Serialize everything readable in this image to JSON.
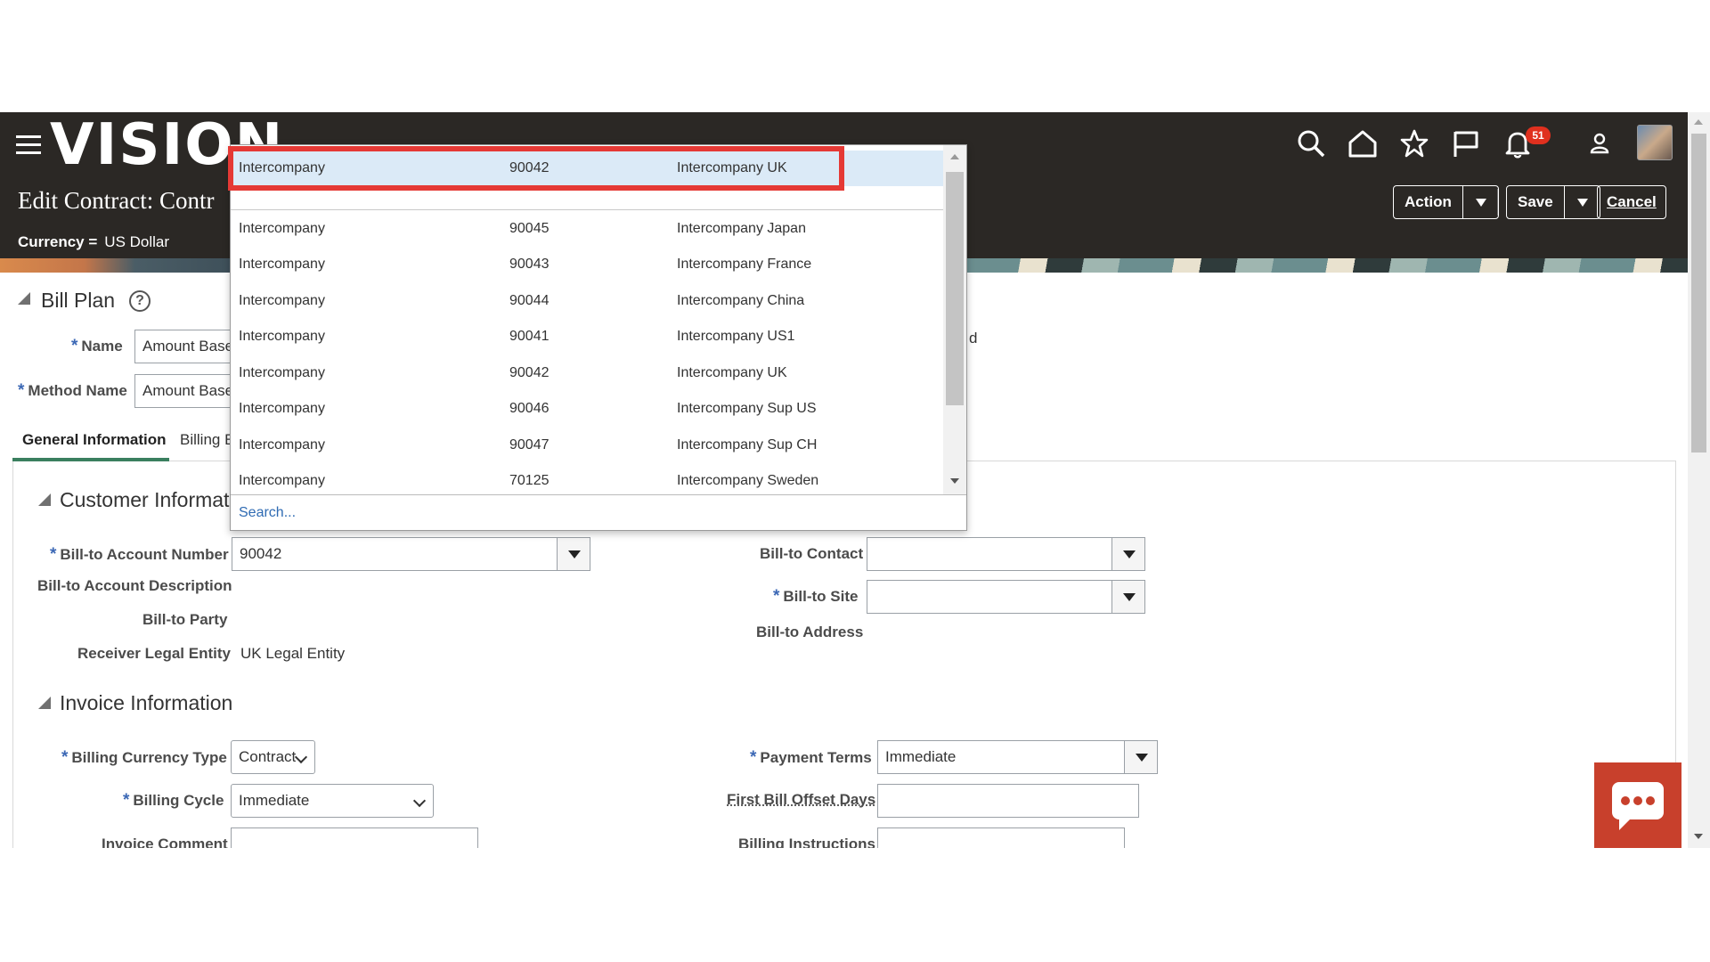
{
  "header": {
    "logo": "VISION",
    "page_title": "Edit Contract: Contr",
    "currency_label": "Currency =",
    "currency_value": "US Dollar",
    "notification_count": "51",
    "buttons": {
      "action": "Action",
      "save": "Save",
      "cancel": "Cancel"
    }
  },
  "bill_plan": {
    "title": "Bill Plan",
    "name_label": "Name",
    "name_value": "Amount Based",
    "method_name_label": "Method Name",
    "method_name_value": "Amount Based",
    "partial_text": "d"
  },
  "tabs": [
    {
      "label": "General Information"
    },
    {
      "label": "Billing E"
    }
  ],
  "customer_info": {
    "title": "Customer Informatic",
    "bill_to_account_number_label": "Bill-to Account Number",
    "bill_to_account_number_value": "90042",
    "bill_to_account_description_label": "Bill-to Account Description",
    "bill_to_party_label": "Bill-to Party",
    "receiver_legal_entity_label": "Receiver Legal Entity",
    "receiver_legal_entity_value": "UK Legal Entity",
    "bill_to_contact_label": "Bill-to Contact",
    "bill_to_site_label": "Bill-to Site",
    "bill_to_address_label": "Bill-to Address"
  },
  "invoice_info": {
    "title": "Invoice Information",
    "billing_currency_type_label": "Billing Currency Type",
    "billing_currency_type_value": "Contract",
    "billing_cycle_label": "Billing Cycle",
    "billing_cycle_value": "Immediate",
    "invoice_comment_label": "Invoice Comment",
    "payment_terms_label": "Payment Terms",
    "payment_terms_value": "Immediate",
    "first_bill_offset_days_label": "First Bill Offset Days",
    "billing_instructions_label": "Billing Instructions"
  },
  "dropdown": {
    "selected": {
      "name": "Intercompany",
      "number": "90042",
      "description": "Intercompany UK"
    },
    "rows": [
      {
        "name": "Intercompany",
        "number": "90045",
        "description": "Intercompany Japan"
      },
      {
        "name": "Intercompany",
        "number": "90043",
        "description": "Intercompany France"
      },
      {
        "name": "Intercompany",
        "number": "90044",
        "description": "Intercompany China"
      },
      {
        "name": "Intercompany",
        "number": "90041",
        "description": "Intercompany US1"
      },
      {
        "name": "Intercompany",
        "number": "90042",
        "description": "Intercompany UK"
      },
      {
        "name": "Intercompany",
        "number": "90046",
        "description": "Intercompany Sup US"
      },
      {
        "name": "Intercompany",
        "number": "90047",
        "description": "Intercompany Sup CH"
      },
      {
        "name": "Intercompany",
        "number": "70125",
        "description": "Intercompany Sweden"
      }
    ],
    "search_link": "Search..."
  },
  "colors": {
    "header_bg": "#2b2825",
    "highlight": "#e53935",
    "accent_blue": "#3c68b5",
    "chat": "#c8402c"
  }
}
